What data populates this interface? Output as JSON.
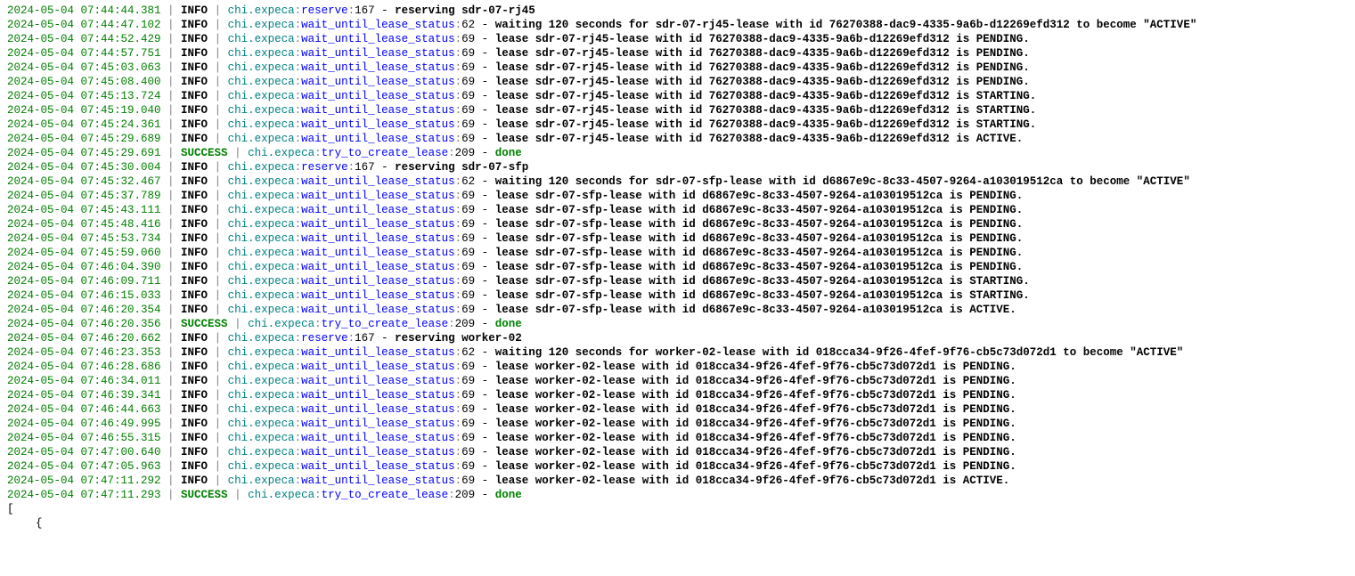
{
  "sep": " | ",
  "dash": " - ",
  "levels": {
    "INFO": "INFO",
    "SUCCESS": "SUCCESS"
  },
  "modules": {
    "chi": "chi.expeca"
  },
  "funcs": {
    "reserve": "reserve",
    "wait": "wait_until_lease_status",
    "create": "try_to_create_lease"
  },
  "linenos": {
    "reserve": "167",
    "wait62": "62",
    "wait69": "69",
    "create": "209"
  },
  "done": "done",
  "trail_bracket": "[",
  "trail_brace": "{",
  "logs": [
    {
      "ts": "2024-05-04 07:44:44.381",
      "level": "INFO",
      "func": "reserve",
      "ln": "167",
      "msg": "reserving sdr-07-rj45"
    },
    {
      "ts": "2024-05-04 07:44:47.102",
      "level": "INFO",
      "func": "wait",
      "ln": "62",
      "msg": "waiting 120 seconds for sdr-07-rj45-lease with id 76270388-dac9-4335-9a6b-d12269efd312 to become \"ACTIVE\""
    },
    {
      "ts": "2024-05-04 07:44:52.429",
      "level": "INFO",
      "func": "wait",
      "ln": "69",
      "msg": "lease sdr-07-rj45-lease with id 76270388-dac9-4335-9a6b-d12269efd312 is PENDING."
    },
    {
      "ts": "2024-05-04 07:44:57.751",
      "level": "INFO",
      "func": "wait",
      "ln": "69",
      "msg": "lease sdr-07-rj45-lease with id 76270388-dac9-4335-9a6b-d12269efd312 is PENDING."
    },
    {
      "ts": "2024-05-04 07:45:03.063",
      "level": "INFO",
      "func": "wait",
      "ln": "69",
      "msg": "lease sdr-07-rj45-lease with id 76270388-dac9-4335-9a6b-d12269efd312 is PENDING."
    },
    {
      "ts": "2024-05-04 07:45:08.400",
      "level": "INFO",
      "func": "wait",
      "ln": "69",
      "msg": "lease sdr-07-rj45-lease with id 76270388-dac9-4335-9a6b-d12269efd312 is PENDING."
    },
    {
      "ts": "2024-05-04 07:45:13.724",
      "level": "INFO",
      "func": "wait",
      "ln": "69",
      "msg": "lease sdr-07-rj45-lease with id 76270388-dac9-4335-9a6b-d12269efd312 is STARTING."
    },
    {
      "ts": "2024-05-04 07:45:19.040",
      "level": "INFO",
      "func": "wait",
      "ln": "69",
      "msg": "lease sdr-07-rj45-lease with id 76270388-dac9-4335-9a6b-d12269efd312 is STARTING."
    },
    {
      "ts": "2024-05-04 07:45:24.361",
      "level": "INFO",
      "func": "wait",
      "ln": "69",
      "msg": "lease sdr-07-rj45-lease with id 76270388-dac9-4335-9a6b-d12269efd312 is STARTING."
    },
    {
      "ts": "2024-05-04 07:45:29.689",
      "level": "INFO",
      "func": "wait",
      "ln": "69",
      "msg": "lease sdr-07-rj45-lease with id 76270388-dac9-4335-9a6b-d12269efd312 is ACTIVE."
    },
    {
      "ts": "2024-05-04 07:45:29.691",
      "level": "SUCCESS",
      "func": "create",
      "ln": "209",
      "msg": "done",
      "done": true
    },
    {
      "ts": "2024-05-04 07:45:30.004",
      "level": "INFO",
      "func": "reserve",
      "ln": "167",
      "msg": "reserving sdr-07-sfp"
    },
    {
      "ts": "2024-05-04 07:45:32.467",
      "level": "INFO",
      "func": "wait",
      "ln": "62",
      "msg": "waiting 120 seconds for sdr-07-sfp-lease with id d6867e9c-8c33-4507-9264-a103019512ca to become \"ACTIVE\""
    },
    {
      "ts": "2024-05-04 07:45:37.789",
      "level": "INFO",
      "func": "wait",
      "ln": "69",
      "msg": "lease sdr-07-sfp-lease with id d6867e9c-8c33-4507-9264-a103019512ca is PENDING."
    },
    {
      "ts": "2024-05-04 07:45:43.111",
      "level": "INFO",
      "func": "wait",
      "ln": "69",
      "msg": "lease sdr-07-sfp-lease with id d6867e9c-8c33-4507-9264-a103019512ca is PENDING."
    },
    {
      "ts": "2024-05-04 07:45:48.416",
      "level": "INFO",
      "func": "wait",
      "ln": "69",
      "msg": "lease sdr-07-sfp-lease with id d6867e9c-8c33-4507-9264-a103019512ca is PENDING."
    },
    {
      "ts": "2024-05-04 07:45:53.734",
      "level": "INFO",
      "func": "wait",
      "ln": "69",
      "msg": "lease sdr-07-sfp-lease with id d6867e9c-8c33-4507-9264-a103019512ca is PENDING."
    },
    {
      "ts": "2024-05-04 07:45:59.060",
      "level": "INFO",
      "func": "wait",
      "ln": "69",
      "msg": "lease sdr-07-sfp-lease with id d6867e9c-8c33-4507-9264-a103019512ca is PENDING."
    },
    {
      "ts": "2024-05-04 07:46:04.390",
      "level": "INFO",
      "func": "wait",
      "ln": "69",
      "msg": "lease sdr-07-sfp-lease with id d6867e9c-8c33-4507-9264-a103019512ca is PENDING."
    },
    {
      "ts": "2024-05-04 07:46:09.711",
      "level": "INFO",
      "func": "wait",
      "ln": "69",
      "msg": "lease sdr-07-sfp-lease with id d6867e9c-8c33-4507-9264-a103019512ca is STARTING."
    },
    {
      "ts": "2024-05-04 07:46:15.033",
      "level": "INFO",
      "func": "wait",
      "ln": "69",
      "msg": "lease sdr-07-sfp-lease with id d6867e9c-8c33-4507-9264-a103019512ca is STARTING."
    },
    {
      "ts": "2024-05-04 07:46:20.354",
      "level": "INFO",
      "func": "wait",
      "ln": "69",
      "msg": "lease sdr-07-sfp-lease with id d6867e9c-8c33-4507-9264-a103019512ca is ACTIVE."
    },
    {
      "ts": "2024-05-04 07:46:20.356",
      "level": "SUCCESS",
      "func": "create",
      "ln": "209",
      "msg": "done",
      "done": true
    },
    {
      "ts": "2024-05-04 07:46:20.662",
      "level": "INFO",
      "func": "reserve",
      "ln": "167",
      "msg": "reserving worker-02"
    },
    {
      "ts": "2024-05-04 07:46:23.353",
      "level": "INFO",
      "func": "wait",
      "ln": "62",
      "msg": "waiting 120 seconds for worker-02-lease with id 018cca34-9f26-4fef-9f76-cb5c73d072d1 to become \"ACTIVE\""
    },
    {
      "ts": "2024-05-04 07:46:28.686",
      "level": "INFO",
      "func": "wait",
      "ln": "69",
      "msg": "lease worker-02-lease with id 018cca34-9f26-4fef-9f76-cb5c73d072d1 is PENDING."
    },
    {
      "ts": "2024-05-04 07:46:34.011",
      "level": "INFO",
      "func": "wait",
      "ln": "69",
      "msg": "lease worker-02-lease with id 018cca34-9f26-4fef-9f76-cb5c73d072d1 is PENDING."
    },
    {
      "ts": "2024-05-04 07:46:39.341",
      "level": "INFO",
      "func": "wait",
      "ln": "69",
      "msg": "lease worker-02-lease with id 018cca34-9f26-4fef-9f76-cb5c73d072d1 is PENDING."
    },
    {
      "ts": "2024-05-04 07:46:44.663",
      "level": "INFO",
      "func": "wait",
      "ln": "69",
      "msg": "lease worker-02-lease with id 018cca34-9f26-4fef-9f76-cb5c73d072d1 is PENDING."
    },
    {
      "ts": "2024-05-04 07:46:49.995",
      "level": "INFO",
      "func": "wait",
      "ln": "69",
      "msg": "lease worker-02-lease with id 018cca34-9f26-4fef-9f76-cb5c73d072d1 is PENDING."
    },
    {
      "ts": "2024-05-04 07:46:55.315",
      "level": "INFO",
      "func": "wait",
      "ln": "69",
      "msg": "lease worker-02-lease with id 018cca34-9f26-4fef-9f76-cb5c73d072d1 is PENDING."
    },
    {
      "ts": "2024-05-04 07:47:00.640",
      "level": "INFO",
      "func": "wait",
      "ln": "69",
      "msg": "lease worker-02-lease with id 018cca34-9f26-4fef-9f76-cb5c73d072d1 is PENDING."
    },
    {
      "ts": "2024-05-04 07:47:05.963",
      "level": "INFO",
      "func": "wait",
      "ln": "69",
      "msg": "lease worker-02-lease with id 018cca34-9f26-4fef-9f76-cb5c73d072d1 is PENDING."
    },
    {
      "ts": "2024-05-04 07:47:11.292",
      "level": "INFO",
      "func": "wait",
      "ln": "69",
      "msg": "lease worker-02-lease with id 018cca34-9f26-4fef-9f76-cb5c73d072d1 is ACTIVE."
    },
    {
      "ts": "2024-05-04 07:47:11.293",
      "level": "SUCCESS",
      "func": "create",
      "ln": "209",
      "msg": "done",
      "done": true
    }
  ]
}
